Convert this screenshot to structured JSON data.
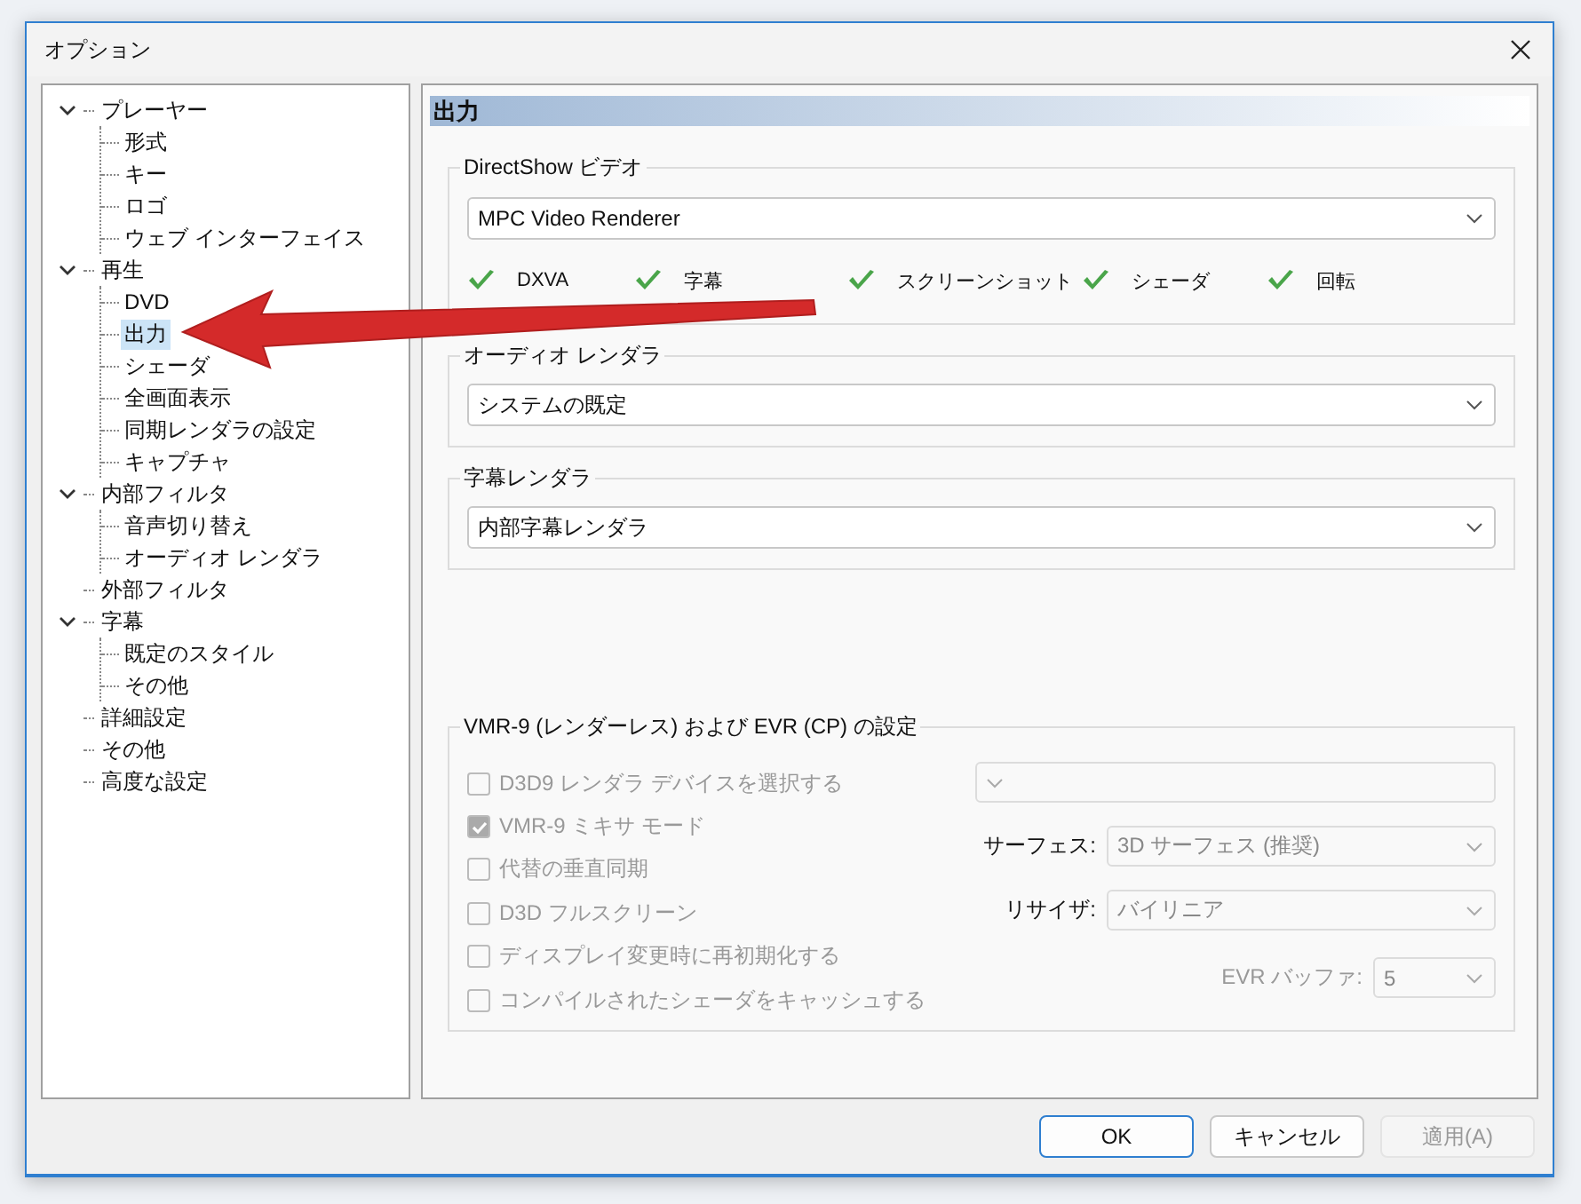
{
  "window": {
    "title": "オプション"
  },
  "tree": [
    {
      "label": "プレーヤー",
      "expanded": true,
      "selected": false,
      "children": [
        {
          "label": "形式",
          "selected": false
        },
        {
          "label": "キー",
          "selected": false
        },
        {
          "label": "ロゴ",
          "selected": false
        },
        {
          "label": "ウェブ インターフェイス",
          "selected": false
        }
      ]
    },
    {
      "label": "再生",
      "expanded": true,
      "selected": false,
      "children": [
        {
          "label": "DVD",
          "selected": false
        },
        {
          "label": "出力",
          "selected": true
        },
        {
          "label": "シェーダ",
          "selected": false
        },
        {
          "label": "全画面表示",
          "selected": false
        },
        {
          "label": "同期レンダラの設定",
          "selected": false
        },
        {
          "label": "キャプチャ",
          "selected": false
        }
      ]
    },
    {
      "label": "内部フィルタ",
      "expanded": true,
      "selected": false,
      "children": [
        {
          "label": "音声切り替え",
          "selected": false
        },
        {
          "label": "オーディオ レンダラ",
          "selected": false
        }
      ]
    },
    {
      "label": "外部フィルタ",
      "selected": false
    },
    {
      "label": "字幕",
      "expanded": true,
      "selected": false,
      "children": [
        {
          "label": "既定のスタイル",
          "selected": false
        },
        {
          "label": "その他",
          "selected": false
        }
      ]
    },
    {
      "label": "詳細設定",
      "selected": false
    },
    {
      "label": "その他",
      "selected": false
    },
    {
      "label": "高度な設定",
      "selected": false
    }
  ],
  "page": {
    "title": "出力"
  },
  "directshow_video": {
    "label": "DirectShow ビデオ",
    "renderer": "MPC Video Renderer",
    "capabilities": [
      {
        "label": "DXVA",
        "supported": true
      },
      {
        "label": "字幕",
        "supported": true
      },
      {
        "label": "スクリーンショット",
        "supported": true
      },
      {
        "label": "シェーダ",
        "supported": true
      },
      {
        "label": "回転",
        "supported": true
      }
    ]
  },
  "audio_renderer": {
    "label": "オーディオ レンダラ",
    "value": "システムの既定"
  },
  "subtitle_renderer": {
    "label": "字幕レンダラ",
    "value": "内部字幕レンダラ"
  },
  "vmr_settings": {
    "label": "VMR-9 (レンダーレス) および EVR (CP) の設定",
    "options": [
      {
        "label": "D3D9 レンダラ デバイスを選択する",
        "checked": false,
        "disabled": true
      },
      {
        "label": "VMR-9 ミキサ モード",
        "checked": true,
        "disabled": true
      },
      {
        "label": "代替の垂直同期",
        "checked": false,
        "disabled": true
      },
      {
        "label": "D3D フルスクリーン",
        "checked": false,
        "disabled": true
      },
      {
        "label": "ディスプレイ変更時に再初期化する",
        "checked": false,
        "disabled": true
      },
      {
        "label": "コンパイルされたシェーダをキャッシュする",
        "checked": false,
        "disabled": true
      }
    ],
    "device": {
      "disabled": true
    },
    "surface": {
      "label": "サーフェス:",
      "value": "3D サーフェス (推奨)",
      "disabled": true,
      "label_disabled": false
    },
    "resizer": {
      "label": "リサイザ:",
      "value": "バイリニア",
      "disabled": true,
      "label_disabled": false
    },
    "evr_buffer": {
      "label": "EVR バッファ:",
      "value": "5",
      "disabled": true,
      "label_disabled": true
    }
  },
  "buttons": [
    {
      "label": "OK",
      "default": true,
      "disabled": false
    },
    {
      "label": "キャンセル",
      "default": false,
      "disabled": false
    },
    {
      "label": "適用(A)",
      "default": false,
      "disabled": true
    }
  ]
}
